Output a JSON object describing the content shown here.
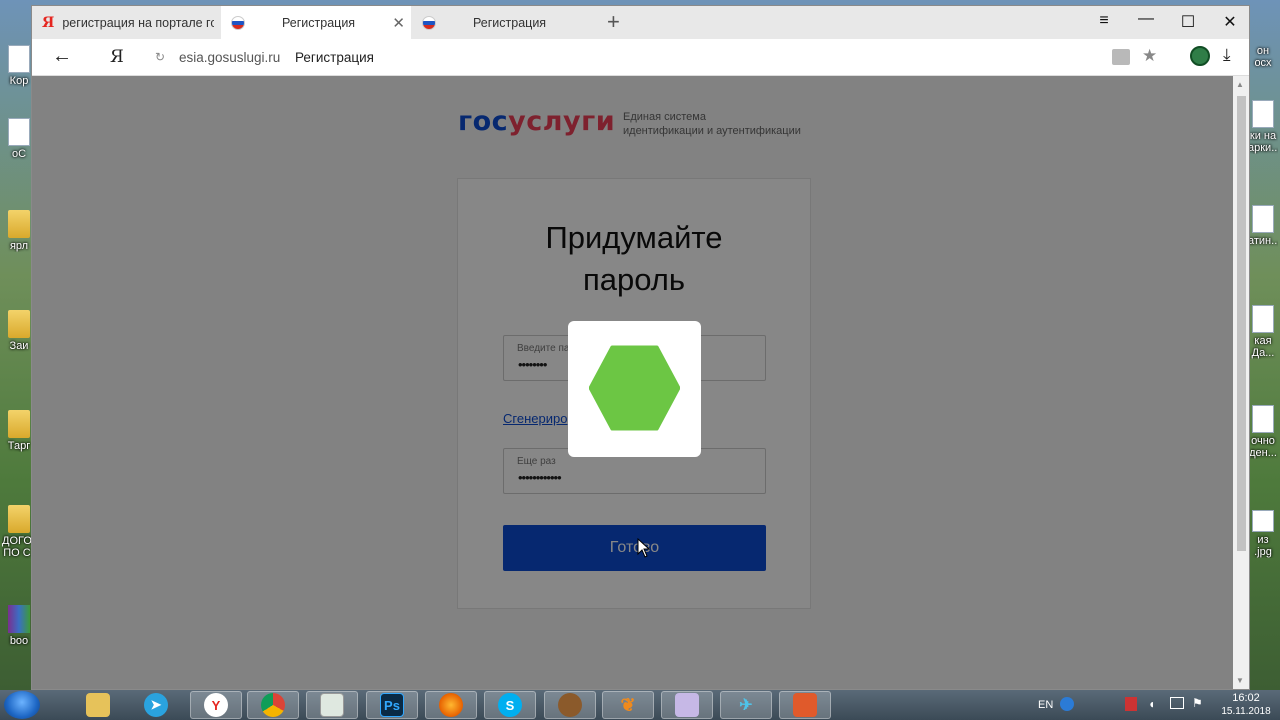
{
  "desktop": {
    "left_icons": [
      "Кор",
      "оС",
      "ярл",
      "Заи",
      "Тарг",
      "ДОГО ПО С",
      "boo"
    ],
    "right_icons": [
      "он осх",
      "ки на арки...",
      "атин...",
      "кая Да...",
      "очно ден...",
      "из .jpg"
    ]
  },
  "browser": {
    "tabs": [
      {
        "title": "регистрация на портале го",
        "favicon": "yandex-icon",
        "active": false
      },
      {
        "title": "Регистрация",
        "favicon": "russia-flag-icon",
        "active": true
      },
      {
        "title": "Регистрация",
        "favicon": "russia-flag-icon",
        "active": false
      }
    ],
    "new_tab": "+",
    "window_controls": {
      "menu": "≡",
      "minimize": "—",
      "maximize": "☐",
      "close": "✕"
    },
    "address": {
      "back": "←",
      "yandex_button": "Я",
      "url": "esia.gosuslugi.ru",
      "page_title": "Регистрация"
    }
  },
  "page": {
    "logo": {
      "part1": "гос",
      "part2": "услуги"
    },
    "logo_subtitle_line1": "Единая система",
    "logo_subtitle_line2": "идентификации и аутентификации",
    "title_line1": "Придумайте",
    "title_line2": "пароль",
    "password_field": {
      "label": "Введите па",
      "value": "••••••••"
    },
    "generate_link": "Сгенериро",
    "confirm_field": {
      "label": "Еще раз",
      "value": "••••••••••••"
    },
    "submit_label": "Готово",
    "loader_color": "#6cc644",
    "accent_color": "#0d4cd3"
  },
  "taskbar": {
    "apps": [
      {
        "name": "explorer-icon",
        "label": ""
      },
      {
        "name": "telegram-icon",
        "label": ""
      },
      {
        "name": "yandex-browser-icon",
        "label": ""
      },
      {
        "name": "chrome-icon",
        "label": ""
      },
      {
        "name": "document-app-icon",
        "label": ""
      },
      {
        "name": "photoshop-icon",
        "label": "Ps"
      },
      {
        "name": "firefox-icon",
        "label": ""
      },
      {
        "name": "skype-icon",
        "label": "S"
      },
      {
        "name": "monkey-app-icon",
        "label": ""
      },
      {
        "name": "butterfly-app-icon",
        "label": ""
      },
      {
        "name": "tool-app-icon",
        "label": ""
      },
      {
        "name": "bird-app-icon",
        "label": ""
      },
      {
        "name": "presentation-app-icon",
        "label": ""
      }
    ],
    "tray": {
      "language": "EN",
      "time": "16:02",
      "date": "15.11.2018"
    }
  }
}
